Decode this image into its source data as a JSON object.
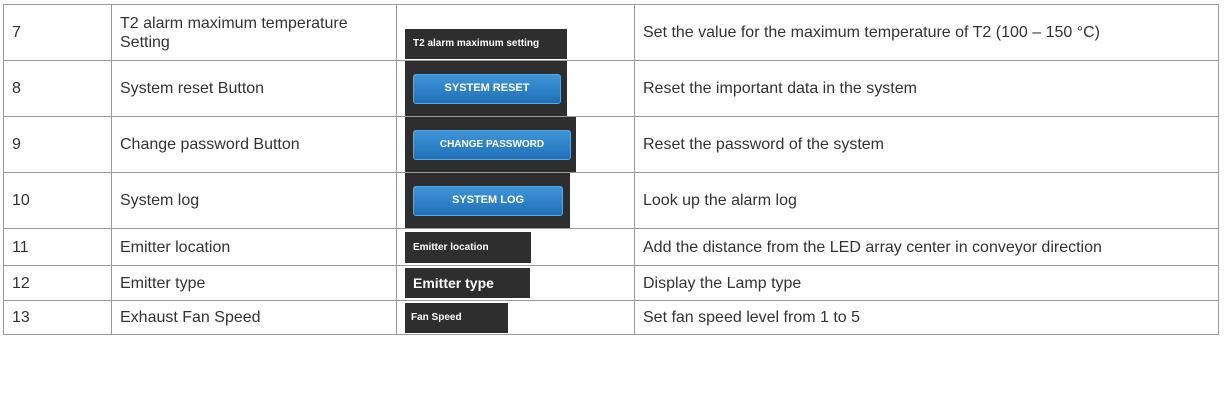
{
  "rows": [
    {
      "num": "7",
      "name": "T2 alarm maximum temperature Setting",
      "image_label": "T2 alarm maximum setting",
      "description": "Set the value for the maximum temperature of T2 (100 – 150 °C)"
    },
    {
      "num": "8",
      "name": "System reset Button",
      "image_label": "SYSTEM RESET",
      "description": "Reset the important data in the system"
    },
    {
      "num": "9",
      "name": "Change password Button",
      "image_label": "CHANGE PASSWORD",
      "description": "Reset the password of the system"
    },
    {
      "num": "10",
      "name": "System log",
      "image_label": "SYSTEM LOG",
      "description": "Look up the alarm log"
    },
    {
      "num": "11",
      "name": "Emitter location",
      "image_label": "Emitter location",
      "description": "Add the distance from the LED array center in conveyor direction"
    },
    {
      "num": "12",
      "name": "Emitter type",
      "image_label": "Emitter type",
      "description": "Display the Lamp type"
    },
    {
      "num": "13",
      "name": "Exhaust Fan Speed",
      "image_label": "Fan Speed",
      "description": "Set fan speed level from 1 to 5"
    }
  ],
  "colors": {
    "button_blue": "#2a82c9",
    "screenshot_bg": "#2e2e2e",
    "border": "#9a9a9a",
    "text": "#333333"
  }
}
